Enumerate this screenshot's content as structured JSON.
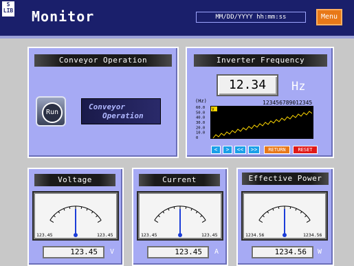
{
  "header": {
    "logo_line1": "S",
    "logo_line2": "LIB",
    "title": "Monitor",
    "datetime": "MM/DD/YYYY hh:mm:ss",
    "menu_label": "Menu"
  },
  "conveyor": {
    "title": "Conveyor Operation",
    "run_label": "Run",
    "label_line1": "Conveyor",
    "label_line2": "Operation"
  },
  "inverter": {
    "title": "Inverter Frequency",
    "value": "12.34",
    "unit": "Hz",
    "graph": {
      "y_unit": "(Hz)",
      "y_ticks": [
        "60.0",
        "50.0",
        "40.0",
        "30.0",
        "20.0",
        "10.0",
        "0"
      ],
      "top_label": "123456789012345",
      "marker": "V"
    },
    "nav": {
      "first": "<",
      "next": ">",
      "prev_page": "<<",
      "next_page": ">>",
      "return": "RETURN",
      "reset": "RESET"
    }
  },
  "voltage": {
    "title": "Voltage",
    "min_label": "123.45",
    "max_label": "123.45",
    "value": "123.45",
    "unit": "V"
  },
  "current": {
    "title": "Current",
    "min_label": "123.45",
    "max_label": "123.45",
    "value": "123.45",
    "unit": "A"
  },
  "power": {
    "title": "Effective Power",
    "min_label": "1234.56",
    "max_label": "1234.56",
    "value": "1234.56",
    "unit": "W"
  },
  "colors": {
    "header_bg": "#1a1f6b",
    "panel_bg": "#a6aaf4",
    "accent_menu": "#e87818",
    "graph_line": "#ffd800",
    "nav_blue": "#1aa0e8",
    "return_orange": "#e87818",
    "reset_red": "#e01818"
  }
}
